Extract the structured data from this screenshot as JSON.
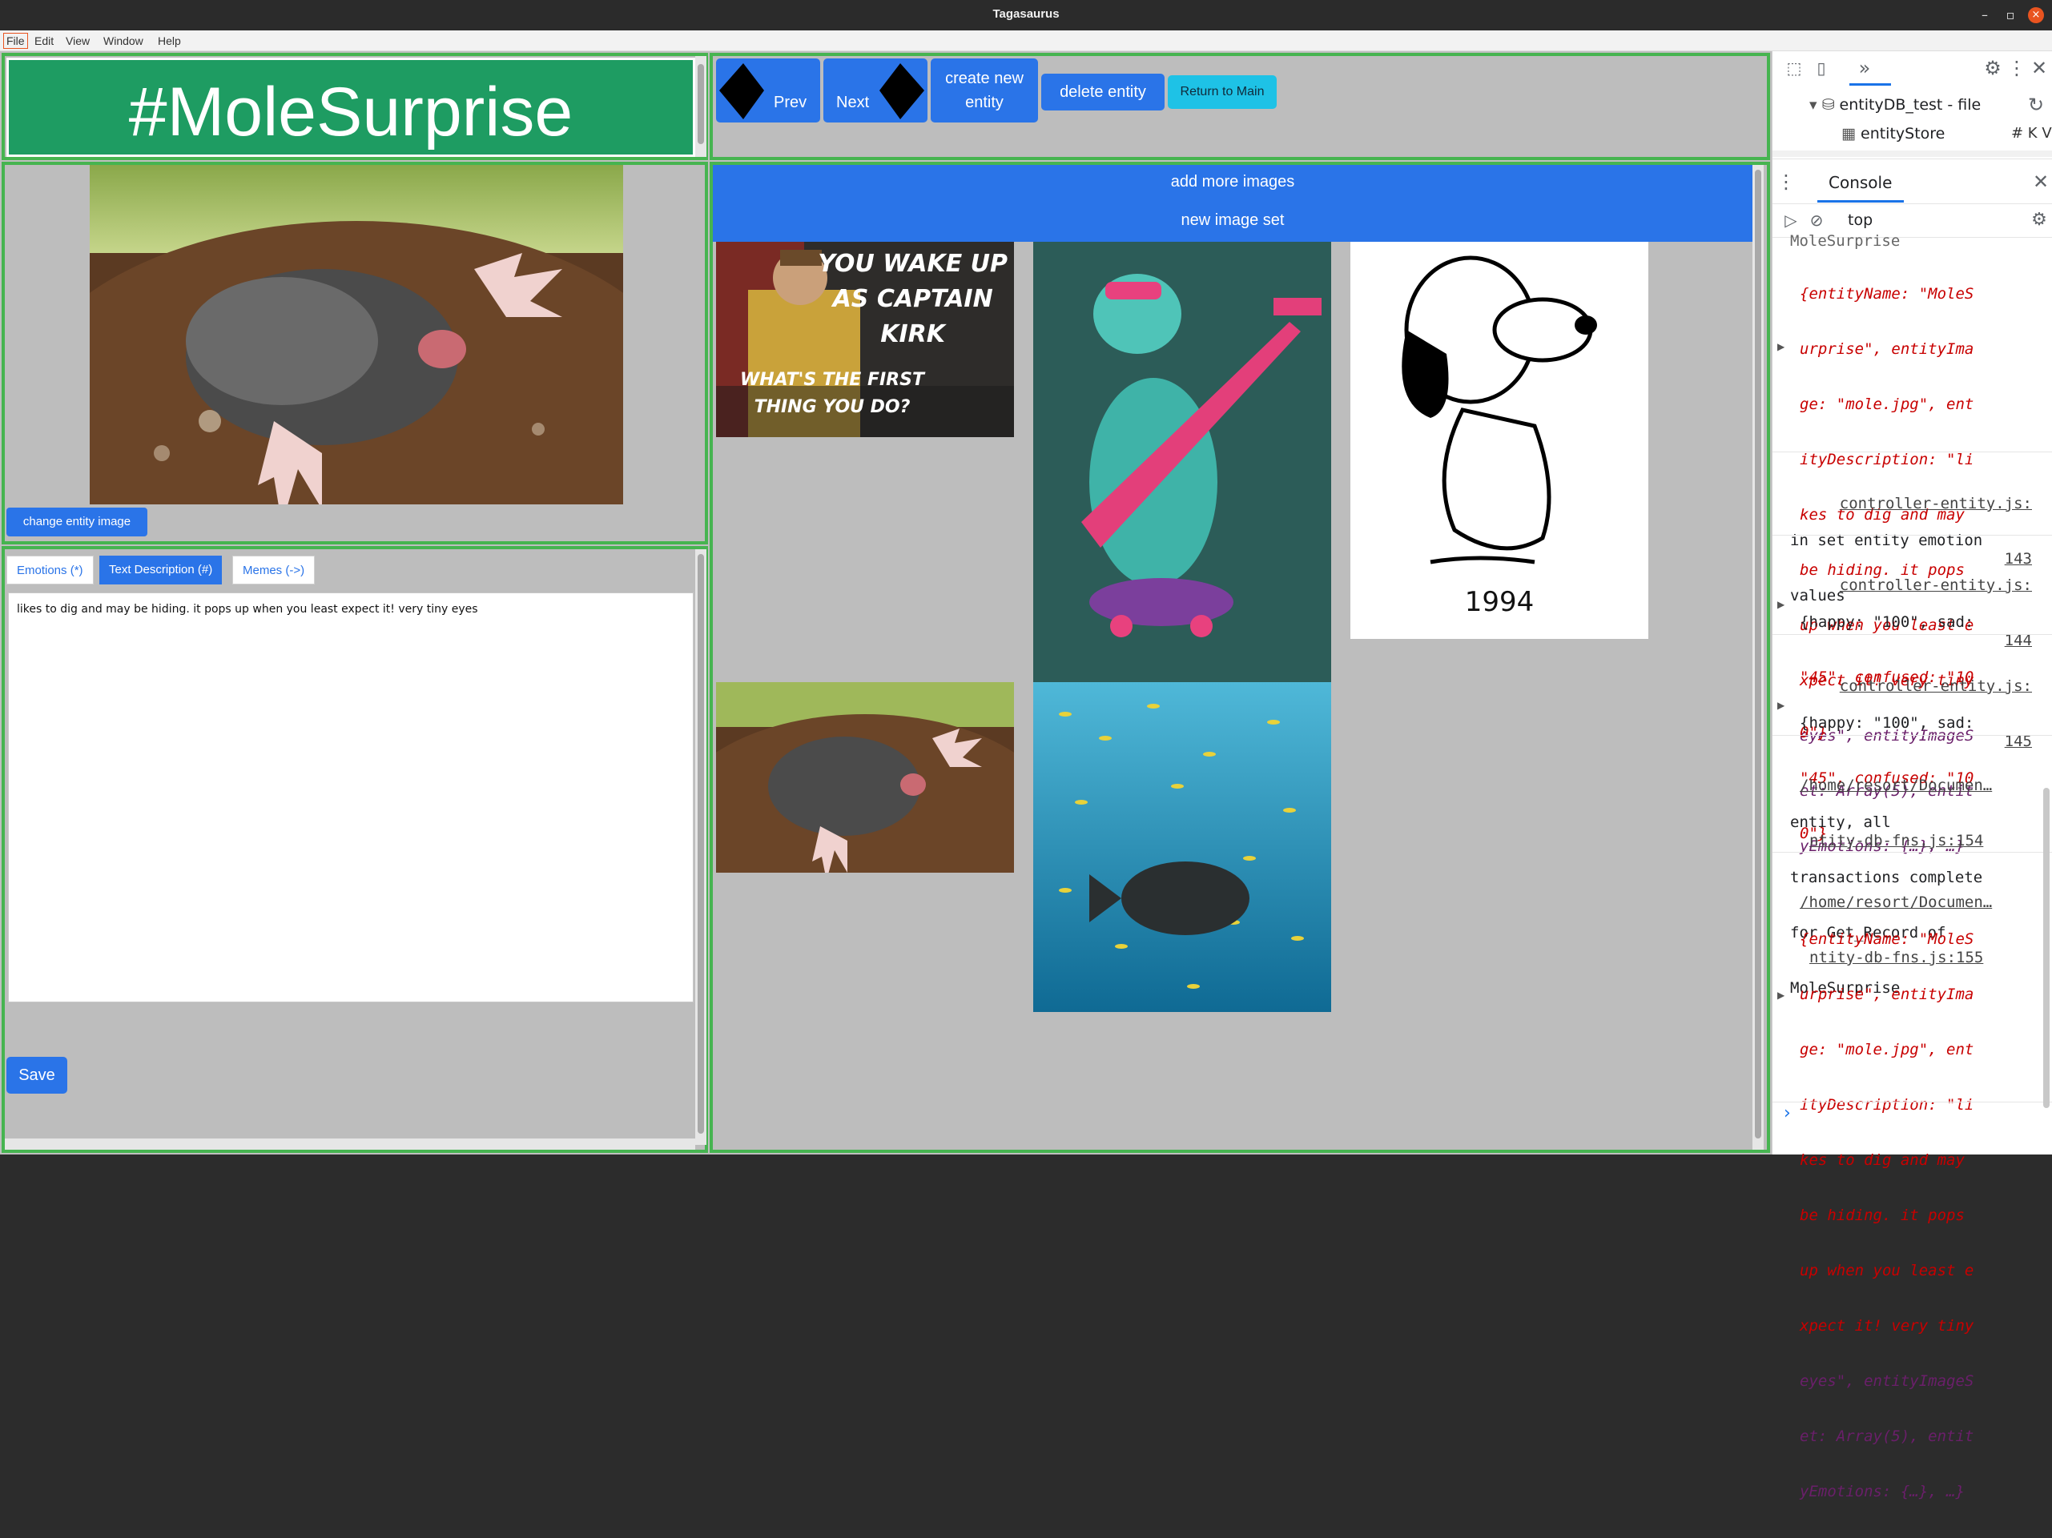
{
  "window": {
    "title": "Tagasaurus",
    "controls": [
      "–",
      "▫",
      "×"
    ]
  },
  "menu": [
    "File",
    "Edit",
    "View",
    "Window",
    "Help"
  ],
  "entity": {
    "name": "#MoleSurprise",
    "change_image_label": "change entity image",
    "description": "likes to dig and may be hiding. it pops up when you least expect it! very tiny eyes"
  },
  "nav": {
    "prev_label": "Prev",
    "next_label": "Next",
    "create_label_1": "create new",
    "create_label_2": "entity",
    "delete_label": "delete entity",
    "return_label": "Return to Main"
  },
  "tabs": [
    {
      "label": "Emotions (*)",
      "active": false
    },
    {
      "label": "Text Description (#)",
      "active": true
    },
    {
      "label": "Memes (->)",
      "active": false
    }
  ],
  "save_label": "Save",
  "memes": {
    "add_images_label": "add more images",
    "new_set_label": "new image set",
    "kirk_caption_top": [
      "YOU WAKE UP",
      "AS CAPTAIN",
      "KIRK"
    ],
    "kirk_caption_bottom": [
      "WHAT'S THE FIRST",
      "THING YOU DO?"
    ],
    "snoopy_year": "1994"
  },
  "devtools": {
    "tree_db": "entityDB_test - file",
    "tree_store": "entityStore",
    "console_tab": "Console",
    "context": "top",
    "entries": [
      {
        "prefix": "MoleSurprise",
        "lines": [
          "{entityName: \"MoleS",
          "urprise\", entityIma",
          "ge: \"mole.jpg\", ent",
          "ityDescription: \"li",
          "kes to dig and may",
          "be hiding. it pops",
          "up when you least e",
          "xpect it! very tiny",
          "eyes\", entityImageS",
          "et: Array(5), entit",
          "yEmotions: {…}, …}"
        ]
      },
      {
        "source": "controller-entity.js:",
        "source_line": "143",
        "lines": [
          "in set entity emotion",
          "values"
        ]
      },
      {
        "source": "controller-entity.js:",
        "source_line": "144",
        "lines": [
          "{happy: \"100\", sad:",
          "\"45\", confused: \"10",
          "0\"}"
        ]
      },
      {
        "source": "controller-entity.js:",
        "source_line": "145",
        "lines": [
          "{happy: \"100\", sad:",
          "\"45\", confused: \"10",
          "0\"}"
        ]
      },
      {
        "source": "/home/resort/Documen…",
        "source_line": "ntity-db-fns.js:154",
        "lines": [
          "entity, all",
          "transactions complete",
          "for Get_Record of",
          "MoleSurprise"
        ]
      },
      {
        "source": "/home/resort/Documen…",
        "source_line": "ntity-db-fns.js:155",
        "lines": [
          "{entityName: \"MoleS",
          "urprise\", entityIma",
          "ge: \"mole.jpg\", ent",
          "ityDescription: \"li",
          "kes to dig and may",
          "be hiding. it pops",
          "up when you least e",
          "xpect it! very tiny",
          "eyes\", entityImageS",
          "et: Array(5), entit",
          "yEmotions: {…}, …}"
        ]
      }
    ],
    "prompt": "›"
  },
  "colors": {
    "panel_border": "#46b450",
    "banner": "#1e9c62",
    "button_blue": "#2a74e8",
    "button_cyan": "#1ec2e6"
  }
}
